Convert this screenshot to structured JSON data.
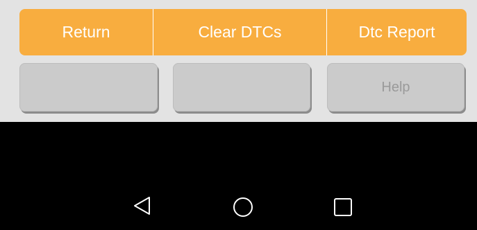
{
  "toolbar": {
    "return_label": "Return",
    "clear_dtcs_label": "Clear DTCs",
    "dtc_report_label": "Dtc Report"
  },
  "secondary_buttons": {
    "button1_label": "",
    "button2_label": "",
    "help_label": "Help"
  },
  "navbar": {
    "back_icon": "back-triangle-icon",
    "home_icon": "home-circle-icon",
    "recent_icon": "recent-apps-square-icon"
  },
  "colors": {
    "accent": "#f8ad3f",
    "button_grey": "#cbcbcb",
    "panel_bg": "#e3e3e3",
    "navbar_bg": "#000000"
  }
}
